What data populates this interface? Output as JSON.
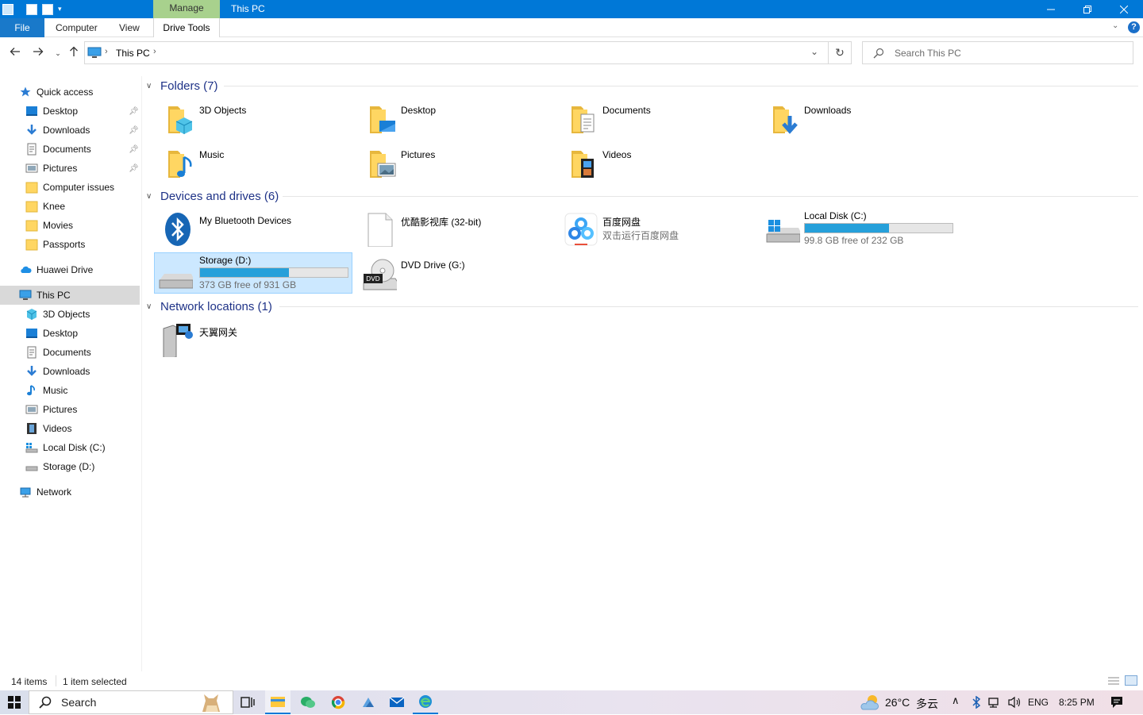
{
  "window": {
    "title": "This PC",
    "contextual_tab": "Manage"
  },
  "ribbon": {
    "file": "File",
    "tabs": [
      "Computer",
      "View",
      "Drive Tools"
    ]
  },
  "address": {
    "location": "This PC",
    "search_placeholder": "Search This PC"
  },
  "nav": {
    "quick_access": "Quick access",
    "quick_items": [
      "Desktop",
      "Downloads",
      "Documents",
      "Pictures",
      "Computer issues",
      "Knee",
      "Movies",
      "Passports"
    ],
    "huawei": "Huawei Drive",
    "this_pc": "This PC",
    "pc_items": [
      "3D Objects",
      "Desktop",
      "Documents",
      "Downloads",
      "Music",
      "Pictures",
      "Videos",
      "Local Disk (C:)",
      "Storage (D:)"
    ],
    "network": "Network"
  },
  "groups": {
    "folders": "Folders (7)",
    "devices": "Devices and drives (6)",
    "network": "Network locations (1)"
  },
  "folders": [
    "3D Objects",
    "Desktop",
    "Documents",
    "Downloads",
    "Music",
    "Pictures",
    "Videos"
  ],
  "devices": {
    "bluetooth": "My Bluetooth Devices",
    "youku": "优酷影视库 (32-bit)",
    "baidu": "百度网盘",
    "baidu_sub": "双击运行百度网盘",
    "c_name": "Local Disk (C:)",
    "c_free": "99.8 GB free of 232 GB",
    "c_used_fraction": 0.57,
    "d_name": "Storage (D:)",
    "d_free": "373 GB free of 931 GB",
    "d_used_fraction": 0.6,
    "dvd": "DVD Drive (G:)"
  },
  "network_locations": [
    "天翼网关"
  ],
  "status": {
    "items": "14 items",
    "selected": "1 item selected"
  },
  "taskbar": {
    "search": "Search",
    "weather": "26°C",
    "weather_desc": "多云",
    "lang": "ENG",
    "time": "8:25 PM"
  },
  "colors": {
    "titlebar": "#0078d7",
    "manage_tab": "#a8d18d",
    "group_header": "#1e3287",
    "drive_bar": "#26a0da",
    "selection": "#cce8ff"
  }
}
